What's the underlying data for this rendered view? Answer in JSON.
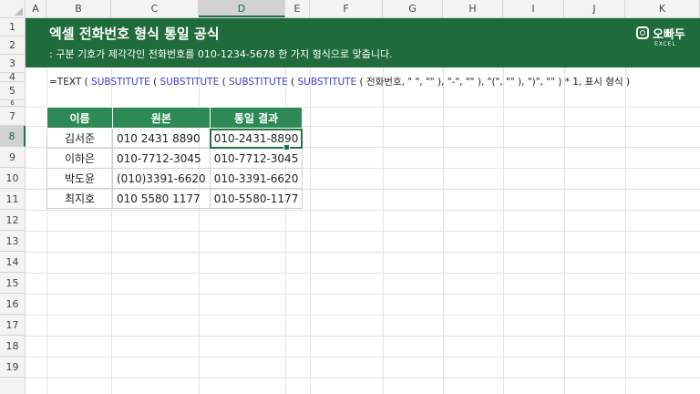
{
  "columns": [
    "A",
    "B",
    "C",
    "D",
    "E",
    "F",
    "G",
    "H",
    "I",
    "J",
    "K"
  ],
  "selected_column": "D",
  "rows": [
    "1",
    "2",
    "3",
    "4",
    "5",
    "6",
    "7",
    "8",
    "9",
    "10",
    "11",
    "12",
    "13",
    "14",
    "15",
    "16",
    "17",
    "18",
    "19"
  ],
  "selected_row": "8",
  "banner": {
    "title": "엑셀 전화번호 형식 통일 공식",
    "subtitle": ": 구분 기호가 제각각인 전화번호를 010-1234-5678 한 가지 형식으로 맞춥니다.",
    "logo_text": "오빠두",
    "logo_small": "EXCEL"
  },
  "formula": {
    "p1": "=TEXT ( ",
    "f1": "SUBSTITUTE",
    "p2": " ( ",
    "f2": "SUBSTITUTE",
    "p3": " ( ",
    "f3": "SUBSTITUTE",
    "p4": " ( ",
    "f4": "SUBSTITUTE",
    "p5": " ( 전화번호, \" \", \"\" ), \"-\", \"\" ), \"(\", \"\" ), \")\", \"\" ) * 1, 표시 형식 )"
  },
  "table": {
    "headers": [
      "이름",
      "원본",
      "통일 결과"
    ],
    "rows": [
      {
        "name": "김서준",
        "orig": "010 2431 8890",
        "result": "010-2431-8890"
      },
      {
        "name": "이하은",
        "orig": "010-7712-3045",
        "result": "010-7712-3045"
      },
      {
        "name": "박도윤",
        "orig": "(010)3391-6620",
        "result": "010-3391-6620"
      },
      {
        "name": "최지호",
        "orig": "010 5580 1177",
        "result": "010-5580-1177"
      }
    ]
  }
}
